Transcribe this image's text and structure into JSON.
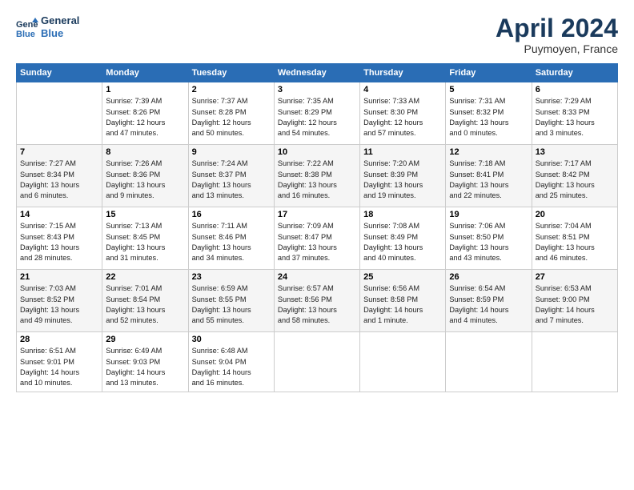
{
  "header": {
    "logo_line1": "General",
    "logo_line2": "Blue",
    "month": "April 2024",
    "location": "Puymoyen, France"
  },
  "columns": [
    "Sunday",
    "Monday",
    "Tuesday",
    "Wednesday",
    "Thursday",
    "Friday",
    "Saturday"
  ],
  "weeks": [
    [
      {
        "day": "",
        "info": ""
      },
      {
        "day": "1",
        "info": "Sunrise: 7:39 AM\nSunset: 8:26 PM\nDaylight: 12 hours\nand 47 minutes."
      },
      {
        "day": "2",
        "info": "Sunrise: 7:37 AM\nSunset: 8:28 PM\nDaylight: 12 hours\nand 50 minutes."
      },
      {
        "day": "3",
        "info": "Sunrise: 7:35 AM\nSunset: 8:29 PM\nDaylight: 12 hours\nand 54 minutes."
      },
      {
        "day": "4",
        "info": "Sunrise: 7:33 AM\nSunset: 8:30 PM\nDaylight: 12 hours\nand 57 minutes."
      },
      {
        "day": "5",
        "info": "Sunrise: 7:31 AM\nSunset: 8:32 PM\nDaylight: 13 hours\nand 0 minutes."
      },
      {
        "day": "6",
        "info": "Sunrise: 7:29 AM\nSunset: 8:33 PM\nDaylight: 13 hours\nand 3 minutes."
      }
    ],
    [
      {
        "day": "7",
        "info": "Sunrise: 7:27 AM\nSunset: 8:34 PM\nDaylight: 13 hours\nand 6 minutes."
      },
      {
        "day": "8",
        "info": "Sunrise: 7:26 AM\nSunset: 8:36 PM\nDaylight: 13 hours\nand 9 minutes."
      },
      {
        "day": "9",
        "info": "Sunrise: 7:24 AM\nSunset: 8:37 PM\nDaylight: 13 hours\nand 13 minutes."
      },
      {
        "day": "10",
        "info": "Sunrise: 7:22 AM\nSunset: 8:38 PM\nDaylight: 13 hours\nand 16 minutes."
      },
      {
        "day": "11",
        "info": "Sunrise: 7:20 AM\nSunset: 8:39 PM\nDaylight: 13 hours\nand 19 minutes."
      },
      {
        "day": "12",
        "info": "Sunrise: 7:18 AM\nSunset: 8:41 PM\nDaylight: 13 hours\nand 22 minutes."
      },
      {
        "day": "13",
        "info": "Sunrise: 7:17 AM\nSunset: 8:42 PM\nDaylight: 13 hours\nand 25 minutes."
      }
    ],
    [
      {
        "day": "14",
        "info": "Sunrise: 7:15 AM\nSunset: 8:43 PM\nDaylight: 13 hours\nand 28 minutes."
      },
      {
        "day": "15",
        "info": "Sunrise: 7:13 AM\nSunset: 8:45 PM\nDaylight: 13 hours\nand 31 minutes."
      },
      {
        "day": "16",
        "info": "Sunrise: 7:11 AM\nSunset: 8:46 PM\nDaylight: 13 hours\nand 34 minutes."
      },
      {
        "day": "17",
        "info": "Sunrise: 7:09 AM\nSunset: 8:47 PM\nDaylight: 13 hours\nand 37 minutes."
      },
      {
        "day": "18",
        "info": "Sunrise: 7:08 AM\nSunset: 8:49 PM\nDaylight: 13 hours\nand 40 minutes."
      },
      {
        "day": "19",
        "info": "Sunrise: 7:06 AM\nSunset: 8:50 PM\nDaylight: 13 hours\nand 43 minutes."
      },
      {
        "day": "20",
        "info": "Sunrise: 7:04 AM\nSunset: 8:51 PM\nDaylight: 13 hours\nand 46 minutes."
      }
    ],
    [
      {
        "day": "21",
        "info": "Sunrise: 7:03 AM\nSunset: 8:52 PM\nDaylight: 13 hours\nand 49 minutes."
      },
      {
        "day": "22",
        "info": "Sunrise: 7:01 AM\nSunset: 8:54 PM\nDaylight: 13 hours\nand 52 minutes."
      },
      {
        "day": "23",
        "info": "Sunrise: 6:59 AM\nSunset: 8:55 PM\nDaylight: 13 hours\nand 55 minutes."
      },
      {
        "day": "24",
        "info": "Sunrise: 6:57 AM\nSunset: 8:56 PM\nDaylight: 13 hours\nand 58 minutes."
      },
      {
        "day": "25",
        "info": "Sunrise: 6:56 AM\nSunset: 8:58 PM\nDaylight: 14 hours\nand 1 minute."
      },
      {
        "day": "26",
        "info": "Sunrise: 6:54 AM\nSunset: 8:59 PM\nDaylight: 14 hours\nand 4 minutes."
      },
      {
        "day": "27",
        "info": "Sunrise: 6:53 AM\nSunset: 9:00 PM\nDaylight: 14 hours\nand 7 minutes."
      }
    ],
    [
      {
        "day": "28",
        "info": "Sunrise: 6:51 AM\nSunset: 9:01 PM\nDaylight: 14 hours\nand 10 minutes."
      },
      {
        "day": "29",
        "info": "Sunrise: 6:49 AM\nSunset: 9:03 PM\nDaylight: 14 hours\nand 13 minutes."
      },
      {
        "day": "30",
        "info": "Sunrise: 6:48 AM\nSunset: 9:04 PM\nDaylight: 14 hours\nand 16 minutes."
      },
      {
        "day": "",
        "info": ""
      },
      {
        "day": "",
        "info": ""
      },
      {
        "day": "",
        "info": ""
      },
      {
        "day": "",
        "info": ""
      }
    ]
  ]
}
